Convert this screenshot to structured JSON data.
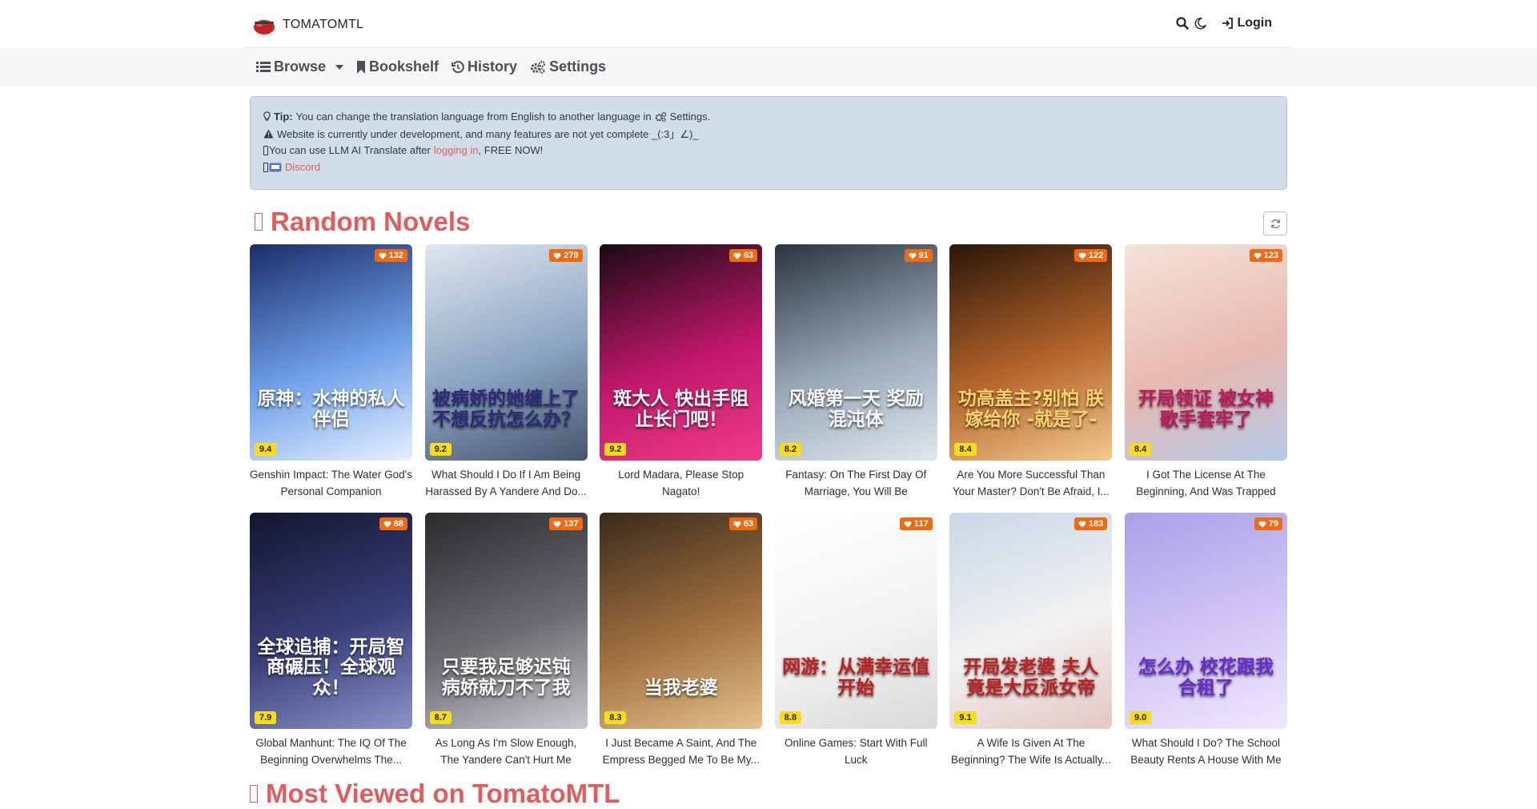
{
  "brand": {
    "name": "TOMATOMTL",
    "logo_icon": "tomato-logo-icon"
  },
  "header": {
    "search_icon": "search-icon",
    "theme_icon": "moon-icon",
    "login_label": "Login"
  },
  "nav": {
    "browse": "Browse",
    "bookshelf": "Bookshelf",
    "history": "History",
    "settings": "Settings"
  },
  "tip": {
    "label": "Tip:",
    "line1": "You can change the translation language from English to another language in",
    "line1_settings": "Settings.",
    "line2": "Website is currently under development, and many features are not yet complete _(:3」∠)_",
    "line3_pre": "You can use LLM AI Translate after",
    "line3_link": "logging in",
    "line3_post": ", FREE NOW!",
    "line4_link": "Discord"
  },
  "random_section": {
    "title": "Random Novels"
  },
  "most_viewed_section": {
    "title": "Most Viewed on TomatoMTL"
  },
  "colors": {
    "accent": "#e25c5c",
    "likes_badge": "#ee6b12",
    "score_badge": "#f8dd16",
    "tip_bg": "#d1dde8"
  },
  "novels_row1": [
    {
      "title": "Genshin Impact: The Water God's Personal Companion",
      "likes": "132",
      "score": "9.4",
      "cover_text": "原神：水神的私人伴侣"
    },
    {
      "title": "What Should I Do If I Am Being Harassed By A Yandere And Do...",
      "likes": "279",
      "score": "9.2",
      "cover_text": "被病娇的她缠上了 不想反抗怎么办？"
    },
    {
      "title": "Lord Madara, Please Stop Nagato!",
      "likes": "63",
      "score": "9.2",
      "cover_text": "斑大人 快出手阻止长门吧！"
    },
    {
      "title": "Fantasy: On The First Day Of Marriage, You Will Be Rewarded...",
      "likes": "91",
      "score": "8.2",
      "cover_text": "风婚第一天 奖励混沌体"
    },
    {
      "title": "Are You More Successful Than Your Master? Don't Be Afraid, I...",
      "likes": "122",
      "score": "8.4",
      "cover_text": "功高盖主?别怕 朕嫁给你 -就是了-"
    },
    {
      "title": "I Got The License At The Beginning, And Was Trapped By...",
      "likes": "123",
      "score": "8.4",
      "cover_text": "开局领证 被女神歌手套牢了"
    }
  ],
  "novels_row2": [
    {
      "title": "Global Manhunt: The IQ Of The Beginning Overwhelms The...",
      "likes": "88",
      "score": "7.9",
      "cover_text": "全球追捕：开局智商碾压！全球观众！"
    },
    {
      "title": "As Long As I'm Slow Enough, The Yandere Can't Hurt Me",
      "likes": "137",
      "score": "8.7",
      "cover_text": "只要我足够迟钝 病娇就刀不了我"
    },
    {
      "title": "I Just Became A Saint, And The Empress Begged Me To Be My...",
      "likes": "63",
      "score": "8.3",
      "cover_text": "当我老婆"
    },
    {
      "title": "Online Games: Start With Full Luck",
      "likes": "117",
      "score": "8.8",
      "cover_text": "网游：从满幸运值开始"
    },
    {
      "title": "A Wife Is Given At The Beginning? The Wife Is Actually...",
      "likes": "183",
      "score": "9.1",
      "cover_text": "开局发老婆 夫人竟是大反派女帝"
    },
    {
      "title": "What Should I Do? The School Beauty Rents A House With Me",
      "likes": "79",
      "score": "9.0",
      "cover_text": "怎么办 校花跟我合租了"
    }
  ]
}
